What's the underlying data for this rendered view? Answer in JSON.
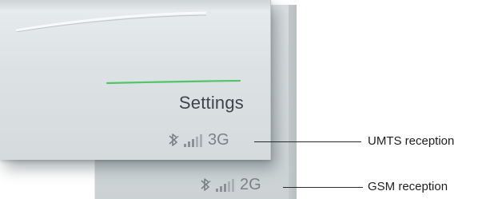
{
  "screen": {
    "title": "Settings"
  },
  "status_umts": {
    "icons": [
      "bluetooth-icon",
      "signal-strength-icon"
    ],
    "network": "3G"
  },
  "status_gsm": {
    "icons": [
      "bluetooth-icon",
      "signal-strength-icon"
    ],
    "network": "2G"
  },
  "callouts": {
    "umts": "UMTS reception",
    "gsm": "GSM reception"
  },
  "colors": {
    "accent_line": "#52c46a",
    "screen": "#dde2e4",
    "status_text": "#7b8286"
  }
}
